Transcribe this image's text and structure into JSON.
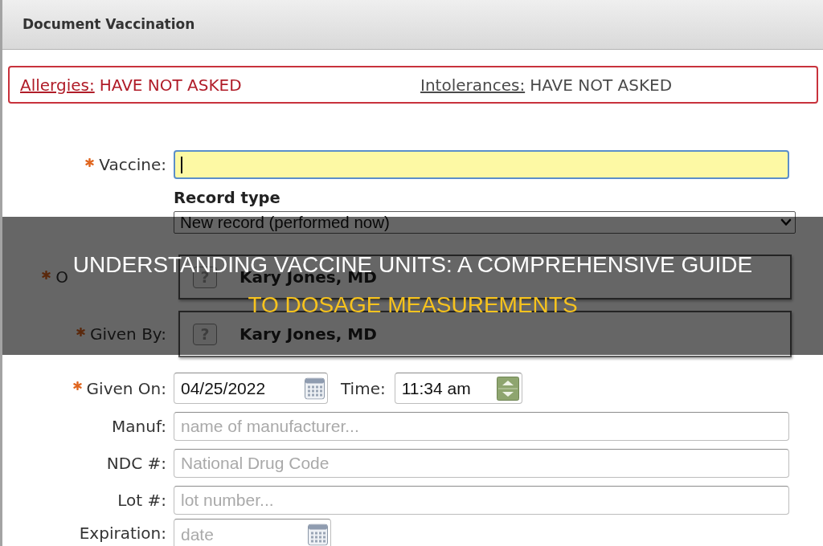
{
  "window": {
    "title": "Document Vaccination"
  },
  "alert": {
    "items": [
      {
        "label": "Allergies:",
        "value": "HAVE NOT ASKED",
        "kind": "warning"
      },
      {
        "label": "Intolerances:",
        "value": "HAVE NOT ASKED",
        "kind": "neutral"
      }
    ]
  },
  "form": {
    "fields": [
      {
        "kind": "text",
        "label": "Vaccine:",
        "required": true,
        "focused": true
      },
      {
        "kind": "select",
        "label": "Record type",
        "required": false,
        "value": "New record (performed now)"
      },
      {
        "kind": "person",
        "label": "O",
        "required": true,
        "covered": true,
        "value": "Kary Jones, MD",
        "badge": "?"
      },
      {
        "kind": "person",
        "label": "Given By:",
        "required": true,
        "covered": false,
        "value": "Kary Jones, MD",
        "badge": "?"
      },
      {
        "kind": "datetime",
        "label": "Given On:",
        "required": true,
        "value": "04/25/2022",
        "time_label": "Time:",
        "time_value": "11:34 am"
      },
      {
        "kind": "text",
        "label": "Manuf:",
        "required": false,
        "focused": false,
        "placeholder": "name of manufacturer..."
      },
      {
        "kind": "text",
        "label": "NDC #:",
        "required": false,
        "focused": false,
        "placeholder": "National Drug Code"
      },
      {
        "kind": "text",
        "label": "Lot #:",
        "required": false,
        "focused": false,
        "placeholder": "lot number..."
      },
      {
        "kind": "date",
        "label": "Expiration:",
        "required": false,
        "placeholder": "date"
      }
    ]
  },
  "banner": {
    "lines": [
      {
        "text": "UNDERSTANDING VACCINE UNITS: A COMPREHENSIVE GUIDE",
        "color": "#ffffff"
      },
      {
        "text": "TO DOSAGE MEASUREMENTS",
        "color": "#f7c31e"
      }
    ]
  }
}
